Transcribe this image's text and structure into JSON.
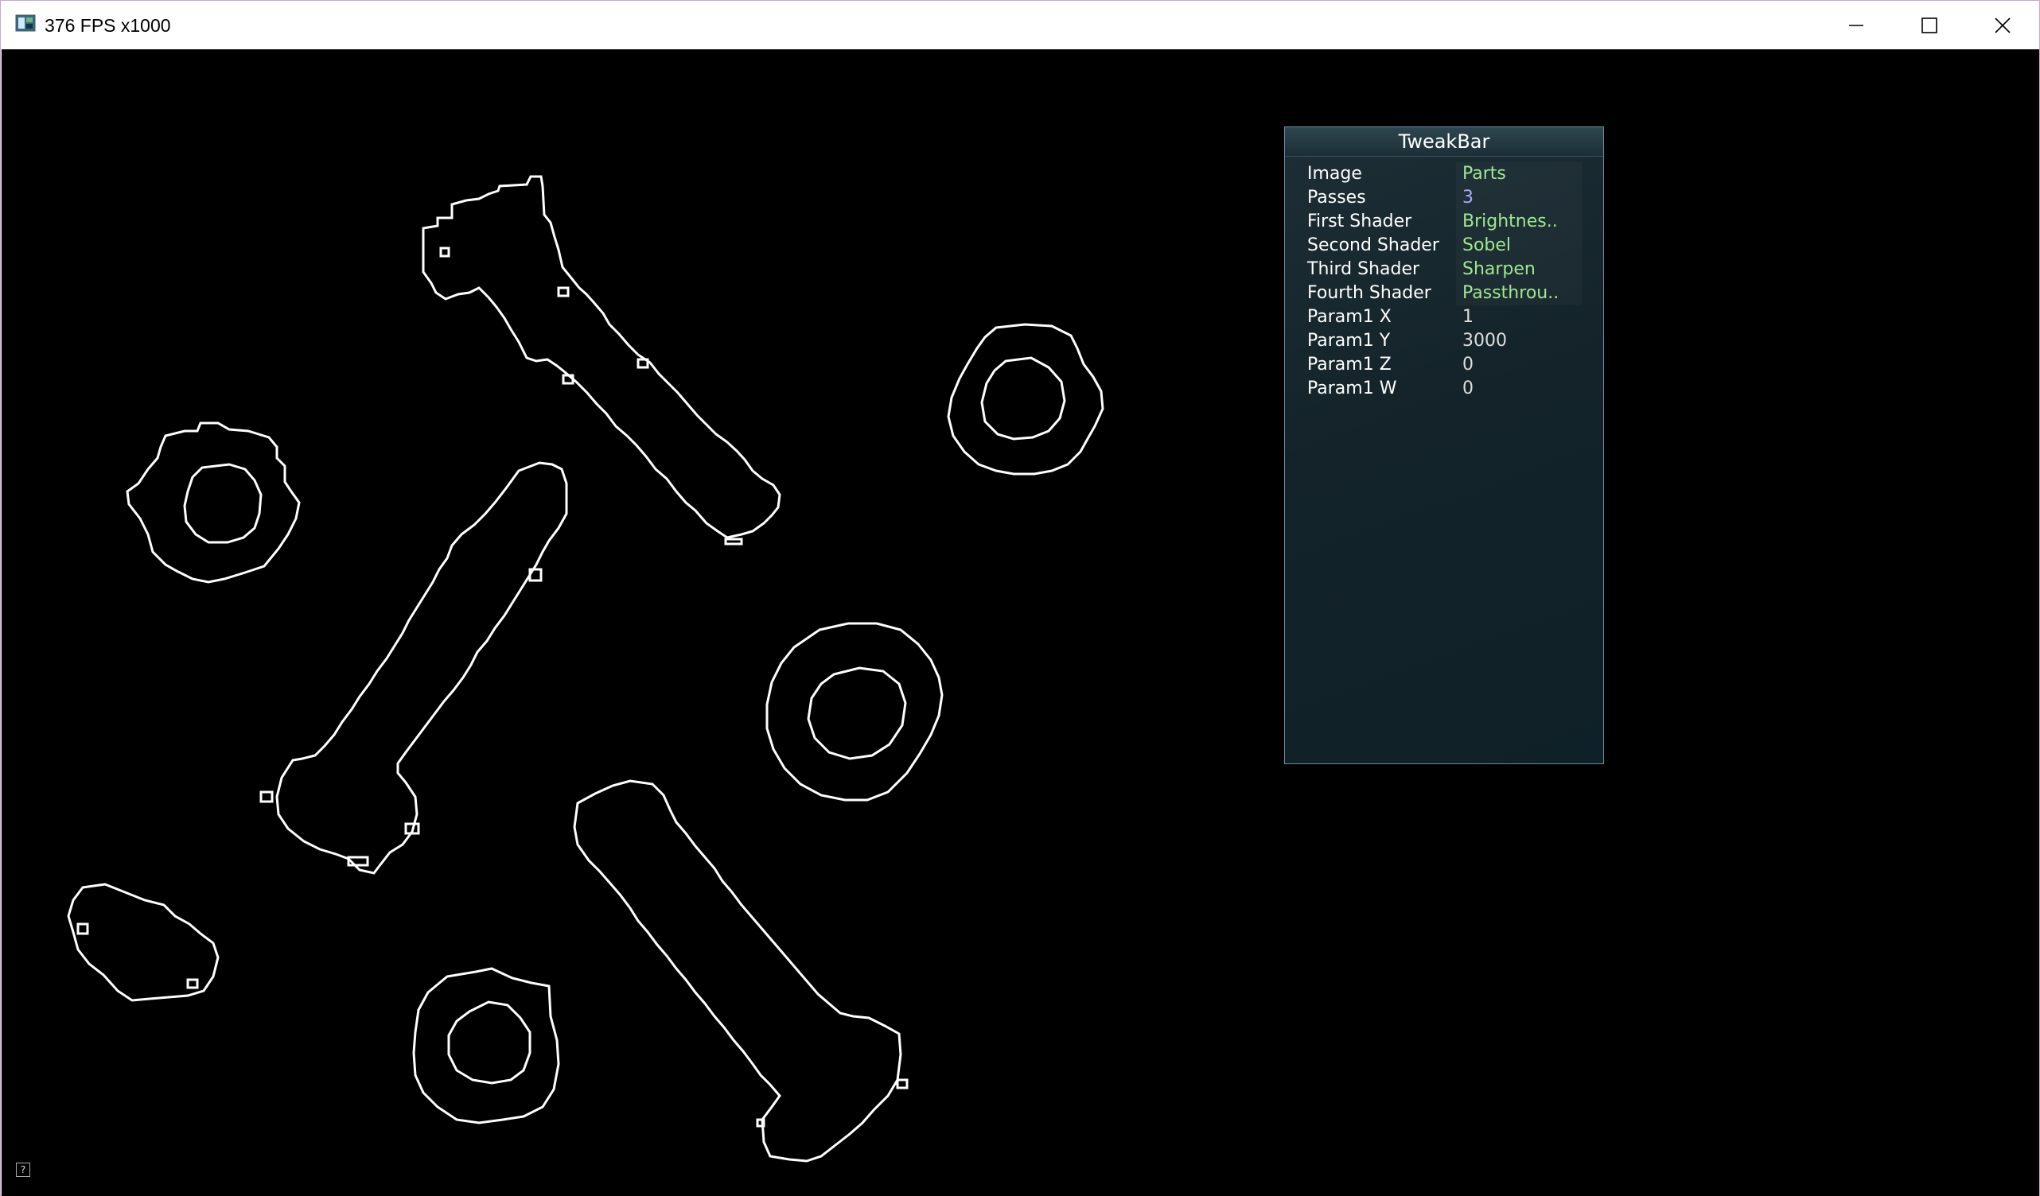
{
  "window": {
    "title": "376 FPS x1000"
  },
  "icons": {
    "app": "app-window-icon",
    "minimize": "minimize-icon",
    "maximize": "maximize-icon",
    "close": "close-icon",
    "help": "help-icon"
  },
  "tweakbar": {
    "title": "TweakBar",
    "rows": [
      {
        "label": "Image",
        "value": "Parts",
        "color": "#9fe88f"
      },
      {
        "label": "Passes",
        "value": "3",
        "color": "#a8a8ff"
      },
      {
        "label": "First Shader",
        "value": "Brightnes..",
        "color": "#9fe88f"
      },
      {
        "label": "Second Shader",
        "value": "Sobel",
        "color": "#9fe88f"
      },
      {
        "label": "Third Shader",
        "value": "Sharpen",
        "color": "#9fe88f"
      },
      {
        "label": "Fourth Shader",
        "value": "Passthrou..",
        "color": "#9fe88f"
      },
      {
        "label": "Param1 X",
        "value": "1",
        "color": "#dddddd"
      },
      {
        "label": "Param1 Y",
        "value": "3000",
        "color": "#dddddd"
      },
      {
        "label": "Param1 Z",
        "value": "0",
        "color": "#dddddd"
      },
      {
        "label": "Param1 W",
        "value": "0",
        "color": "#dddddd"
      }
    ]
  },
  "colors": {
    "viewport_background": "#000000",
    "edge_lines": "#ffffff"
  }
}
